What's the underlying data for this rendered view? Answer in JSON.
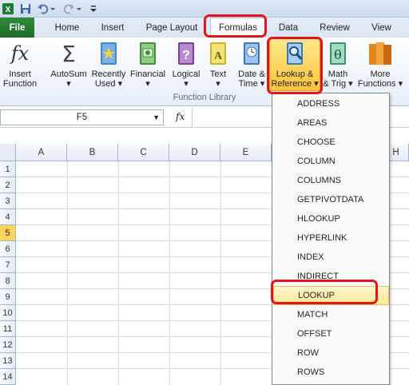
{
  "quick_access": {
    "icons": [
      "excel-logo-icon",
      "save-icon",
      "undo-icon",
      "redo-icon",
      "customize-icon"
    ]
  },
  "tabs": [
    {
      "label": "File"
    },
    {
      "label": "Home"
    },
    {
      "label": "Insert"
    },
    {
      "label": "Page Layout"
    },
    {
      "label": "Formulas",
      "selected": true
    },
    {
      "label": "Data"
    },
    {
      "label": "Review"
    },
    {
      "label": "View"
    }
  ],
  "ribbon": {
    "group_label": "Function Library",
    "buttons": [
      {
        "line1": "Insert",
        "line2": "Function",
        "icon": "fx-icon"
      },
      {
        "line1": "AutoSum",
        "line2": "",
        "icon": "sigma-icon",
        "dropdown": true
      },
      {
        "line1": "Recently",
        "line2": "Used",
        "icon": "star-book-icon",
        "dropdown": true
      },
      {
        "line1": "Financial",
        "line2": "",
        "icon": "money-book-icon",
        "dropdown": true
      },
      {
        "line1": "Logical",
        "line2": "",
        "icon": "question-book-icon",
        "dropdown": true
      },
      {
        "line1": "Text",
        "line2": "",
        "icon": "text-book-icon",
        "dropdown": true
      },
      {
        "line1": "Date &",
        "line2": "Time",
        "icon": "clock-book-icon",
        "dropdown": true
      },
      {
        "line1": "Lookup &",
        "line2": "Reference",
        "icon": "magnifier-book-icon",
        "dropdown": true,
        "active": true
      },
      {
        "line1": "Math",
        "line2": "& Trig",
        "icon": "theta-book-icon",
        "dropdown": true
      },
      {
        "line1": "More",
        "line2": "Functions",
        "icon": "books-stack-icon",
        "dropdown": true
      }
    ]
  },
  "formula_bar": {
    "name_box": "F5",
    "fx_label": "fx",
    "value": ""
  },
  "sheet": {
    "columns": [
      "A",
      "B",
      "C",
      "D",
      "E",
      "H"
    ],
    "rows": [
      "1",
      "2",
      "3",
      "4",
      "5",
      "6",
      "7",
      "8",
      "9",
      "10",
      "11",
      "12",
      "13",
      "14"
    ],
    "selected_row": "5"
  },
  "dropdown_menu": {
    "items": [
      "ADDRESS",
      "AREAS",
      "CHOOSE",
      "COLUMN",
      "COLUMNS",
      "GETPIVOTDATA",
      "HLOOKUP",
      "HYPERLINK",
      "INDEX",
      "INDIRECT",
      "LOOKUP",
      "MATCH",
      "OFFSET",
      "ROW",
      "ROWS"
    ],
    "highlighted": "LOOKUP"
  },
  "colors": {
    "file_tab": "#1d6b2a",
    "highlight_box": "#e0141c",
    "active_button": "#ffc43c",
    "selected_row": "#ffd45a"
  }
}
